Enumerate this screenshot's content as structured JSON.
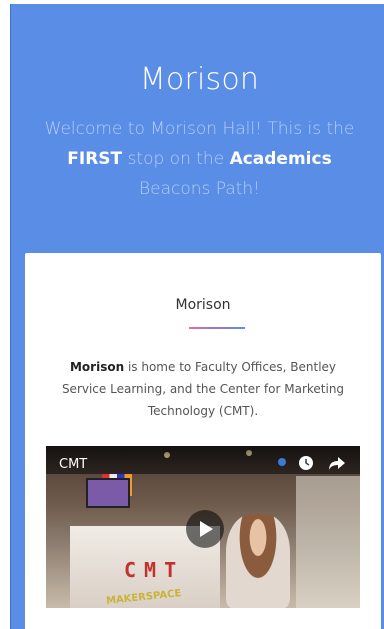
{
  "hero": {
    "title": "Morison",
    "text_1": "Welcome to Morison Hall! This is the ",
    "text_bold_1": "FIRST",
    "text_2": " stop on the ",
    "text_bold_2": "Academics",
    "text_3": " Beacons Path!"
  },
  "card": {
    "title": "Morison",
    "body_bold": "Morison",
    "body_rest": " is home to Faculty Offices, Bentley Service Learning, and the Center for Marketing Technology (CMT)."
  },
  "video": {
    "title": "CMT",
    "scene_sign": "CMT",
    "scene_sub": "MAKERSPACE",
    "icons": [
      "watch-later-icon",
      "share-icon",
      "play-icon"
    ]
  },
  "colors": {
    "hero_bg": "#5a8de6",
    "card_bg": "#ffffff"
  }
}
